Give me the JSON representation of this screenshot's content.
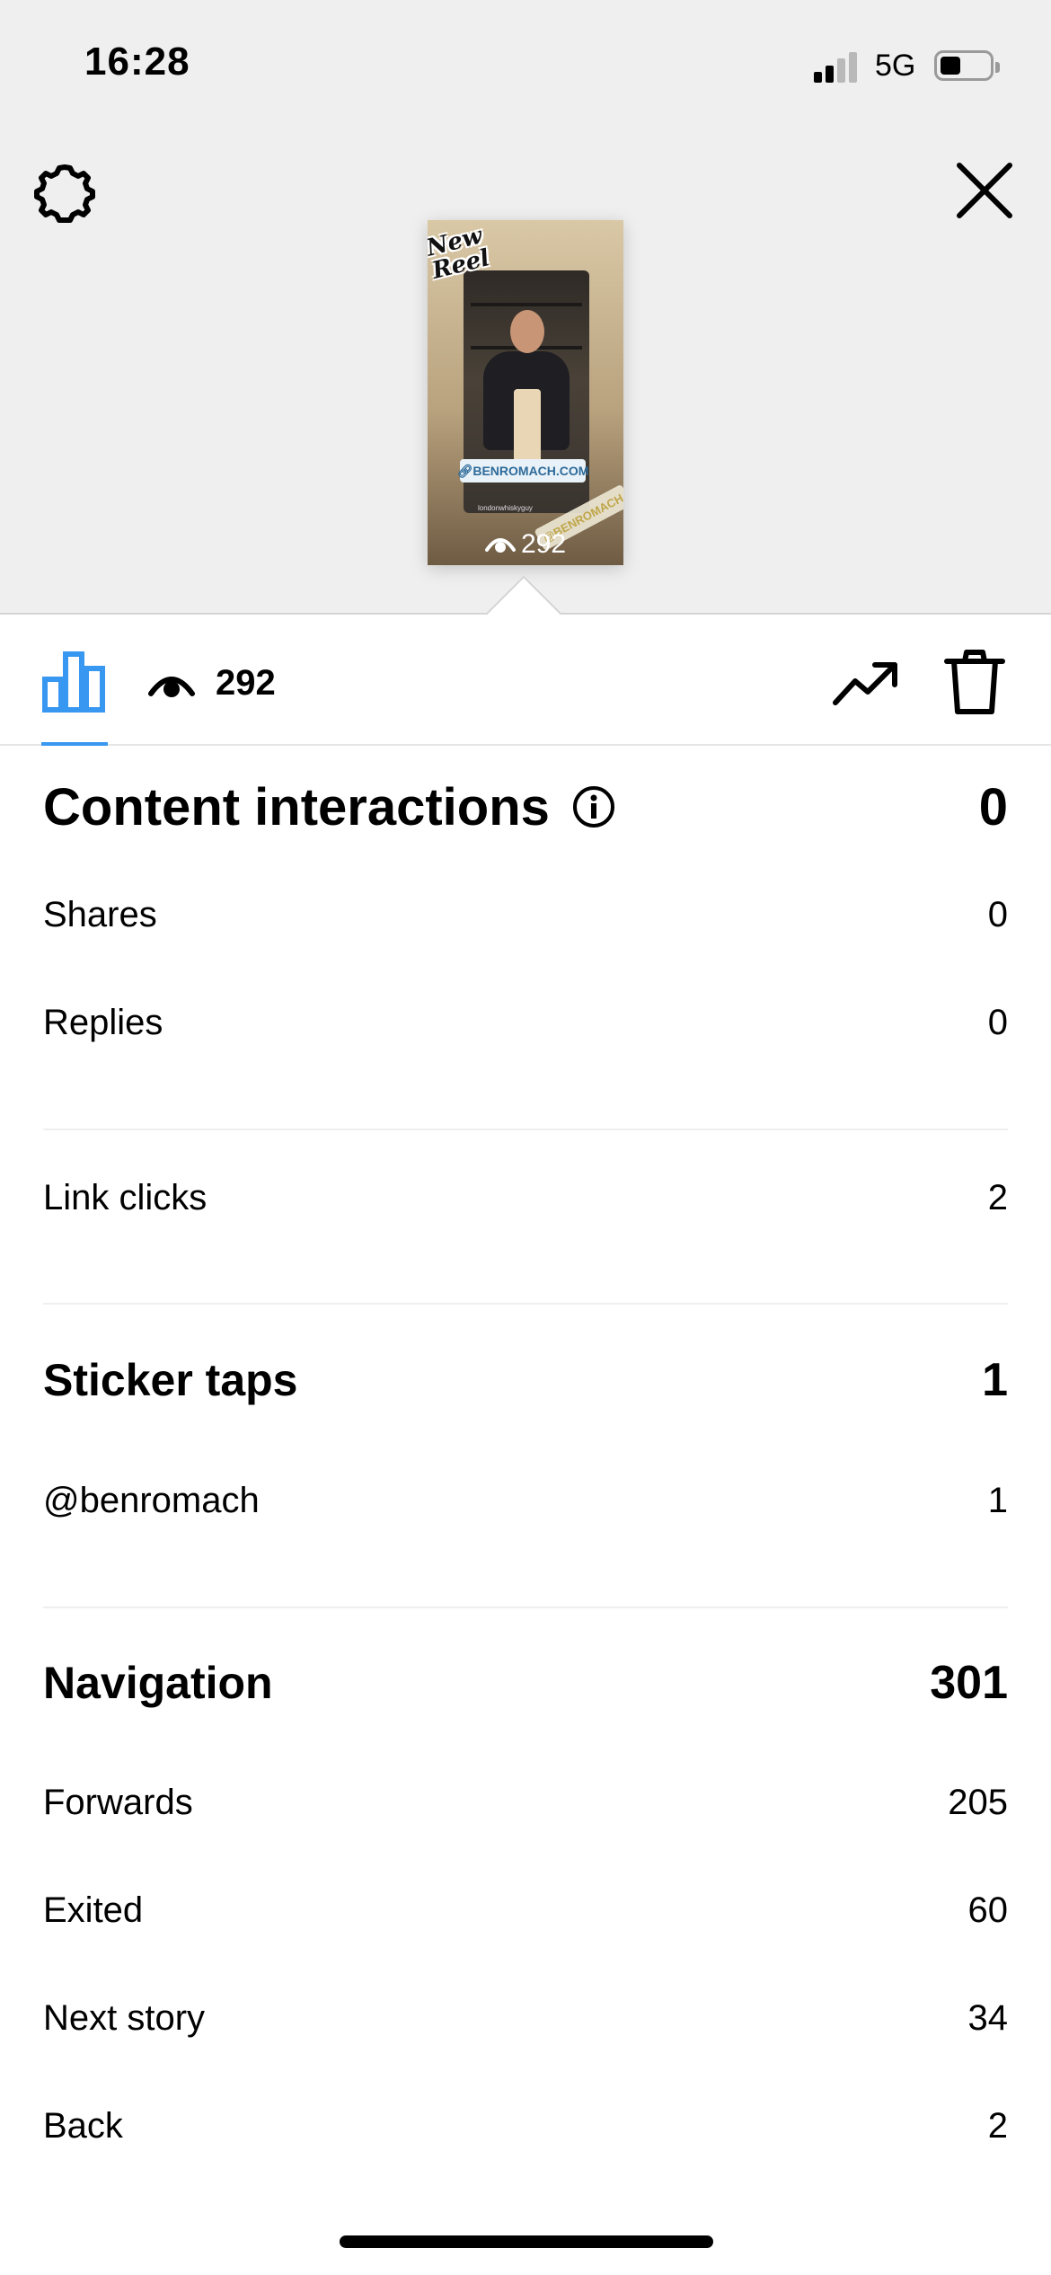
{
  "status_bar": {
    "time": "16:28",
    "network": "5G"
  },
  "preview": {
    "sticker_new_reel": "New Reel",
    "sticker_link": "BENROMACH.COM",
    "sticker_mention": "@BENROMACH",
    "handle": "londonwhiskyguy",
    "views_overlay": "292"
  },
  "tabbar": {
    "views_count": "292"
  },
  "sections": {
    "content_interactions": {
      "label": "Content interactions",
      "value": "0"
    },
    "shares": {
      "label": "Shares",
      "value": "0"
    },
    "replies": {
      "label": "Replies",
      "value": "0"
    },
    "link_clicks": {
      "label": "Link clicks",
      "value": "2"
    },
    "sticker_taps": {
      "label": "Sticker taps",
      "value": "1"
    },
    "benromach": {
      "label": "@benromach",
      "value": "1"
    },
    "navigation": {
      "label": "Navigation",
      "value": "301"
    },
    "forwards": {
      "label": "Forwards",
      "value": "205"
    },
    "exited": {
      "label": "Exited",
      "value": "60"
    },
    "next_story": {
      "label": "Next story",
      "value": "34"
    },
    "back": {
      "label": "Back",
      "value": "2"
    }
  },
  "colors": {
    "accent": "#3897f0",
    "top_background": "#efefef"
  }
}
